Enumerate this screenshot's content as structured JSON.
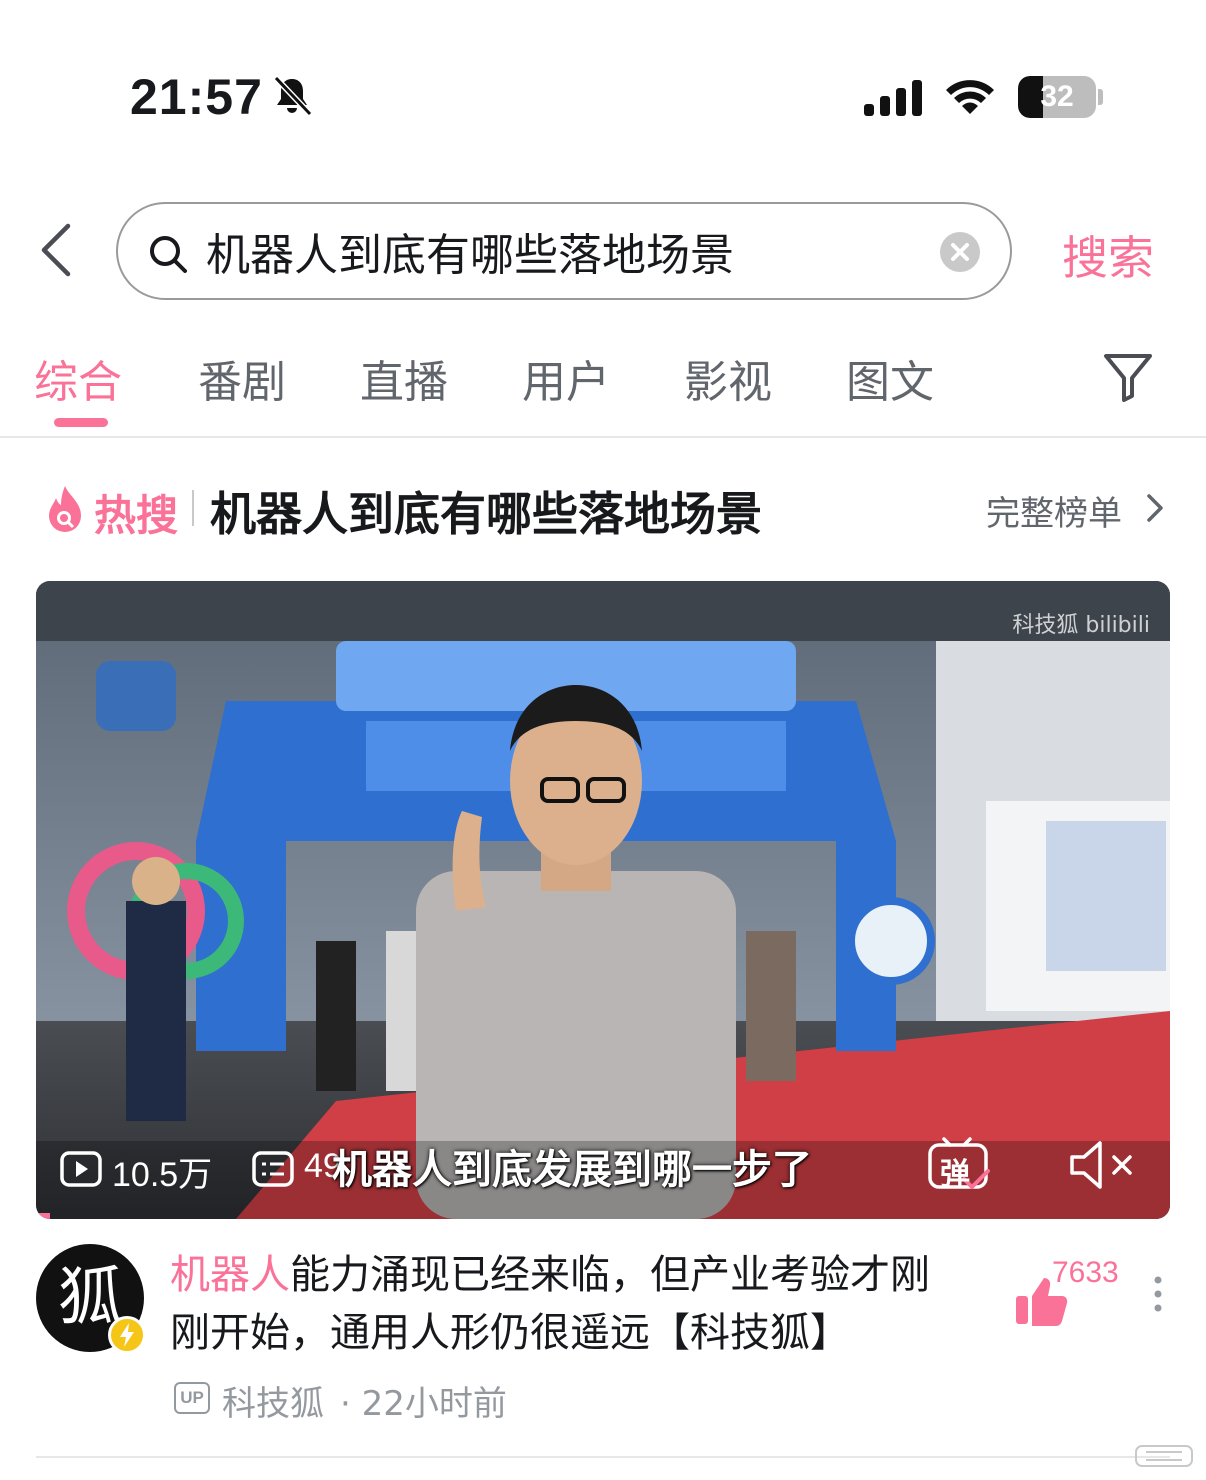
{
  "status_bar": {
    "time": "21:57",
    "battery": "32",
    "battery_level": 0.32,
    "icons": [
      "bell-slash-icon",
      "signal-icon",
      "wifi-icon",
      "battery-icon"
    ]
  },
  "search": {
    "query": "机器人到底有哪些落地场景",
    "submit_label": "搜索"
  },
  "tabs": {
    "items": [
      "综合",
      "番剧",
      "直播",
      "用户",
      "影视",
      "图文"
    ],
    "active_index": 0
  },
  "hot_search": {
    "badge": "热搜",
    "title": "机器人到底有哪些落地场景",
    "full_list_label": "完整榜单"
  },
  "video": {
    "watermark": "科技狐 bilibili",
    "views": "10.5万",
    "danmu_count": "49",
    "subtitle": "机器人到底发展到哪一步了",
    "danmu_toggle_label": "弹",
    "title_highlight": "机器人",
    "title_rest": "能力涌现已经来临，但产业考验才刚刚开始，通用人形仍很遥远【科技狐】",
    "up_tag": "UP",
    "author": "科技狐",
    "time_sep": "·",
    "time_ago": "22小时前",
    "likes": "7633",
    "accent_color": "#fb7299"
  }
}
